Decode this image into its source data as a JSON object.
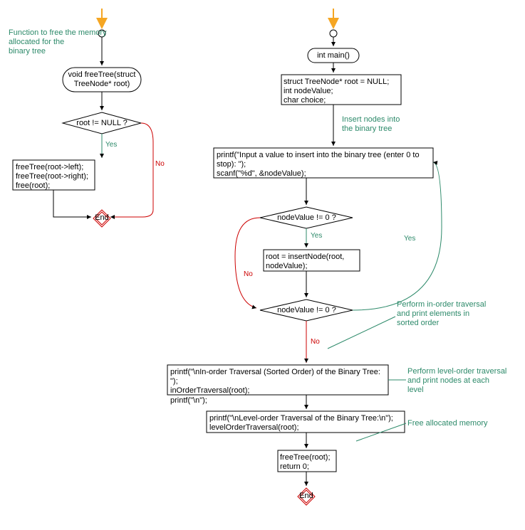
{
  "chart_data": {
    "type": "flowchart",
    "flowcharts": [
      {
        "title_annotation": "Function to free the memory allocated for the binary tree",
        "nodes": [
          {
            "id": "f_start",
            "type": "start",
            "label": ""
          },
          {
            "id": "f_func",
            "type": "terminal",
            "label": "void freeTree(struct TreeNode* root)"
          },
          {
            "id": "f_cond",
            "type": "decision",
            "label": "root != NULL ?"
          },
          {
            "id": "f_body",
            "type": "process",
            "label": "freeTree(root->left);\nfreeTree(root->right);\nfree(root);"
          },
          {
            "id": "f_end",
            "type": "end",
            "label": "End"
          }
        ],
        "edges": [
          {
            "from": "f_start",
            "to": "f_func"
          },
          {
            "from": "f_func",
            "to": "f_cond"
          },
          {
            "from": "f_cond",
            "to": "f_body",
            "label": "Yes"
          },
          {
            "from": "f_cond",
            "to": "f_end",
            "label": "No"
          },
          {
            "from": "f_body",
            "to": "f_end"
          }
        ]
      },
      {
        "nodes": [
          {
            "id": "m_start",
            "type": "start",
            "label": ""
          },
          {
            "id": "m_func",
            "type": "terminal",
            "label": "int main()"
          },
          {
            "id": "m_decl",
            "type": "process",
            "label": "struct TreeNode* root = NULL;\nint nodeValue;\nchar choice;"
          },
          {
            "id": "m_input",
            "type": "process",
            "label": "printf(\"Input a value to insert into the binary tree (enter 0 to stop): \");\nscanf(\"%d\", &nodeValue);"
          },
          {
            "id": "m_cond1",
            "type": "decision",
            "label": "nodeValue != 0 ?"
          },
          {
            "id": "m_insert",
            "type": "process",
            "label": "root = insertNode(root, nodeValue);"
          },
          {
            "id": "m_cond2",
            "type": "decision",
            "label": "nodeValue != 0 ?"
          },
          {
            "id": "m_inorder",
            "type": "process",
            "label": "printf(\"\\nIn-order Traversal (Sorted Order) of the Binary Tree: \");\ninOrderTraversal(root);\nprintf(\"\\n\");"
          },
          {
            "id": "m_level",
            "type": "process",
            "label": "printf(\"\\nLevel-order Traversal of the Binary Tree:\\n\");\nlevelOrderTraversal(root);"
          },
          {
            "id": "m_free",
            "type": "process",
            "label": "freeTree(root);\nreturn 0;"
          },
          {
            "id": "m_end",
            "type": "end",
            "label": "End"
          }
        ],
        "edges": [
          {
            "from": "m_start",
            "to": "m_func"
          },
          {
            "from": "m_func",
            "to": "m_decl"
          },
          {
            "from": "m_decl",
            "to": "m_input",
            "annotation": "Insert nodes into the binary tree"
          },
          {
            "from": "m_input",
            "to": "m_cond1"
          },
          {
            "from": "m_cond1",
            "to": "m_insert",
            "label": "Yes"
          },
          {
            "from": "m_cond1",
            "to": "m_cond2",
            "label": "No"
          },
          {
            "from": "m_insert",
            "to": "m_cond2"
          },
          {
            "from": "m_cond2",
            "to": "m_input",
            "label": "Yes"
          },
          {
            "from": "m_cond2",
            "to": "m_inorder",
            "label": "No",
            "annotation": "Perform in-order traversal and print elements in sorted order"
          },
          {
            "from": "m_inorder",
            "to": "m_level",
            "annotation": "Perform level-order traversal and print nodes at each level"
          },
          {
            "from": "m_level",
            "to": "m_free",
            "annotation": "Free allocated memory"
          },
          {
            "from": "m_free",
            "to": "m_end"
          }
        ]
      }
    ]
  },
  "left": {
    "annotation": "Function to free the memory\nallocated for the\nbinary tree",
    "func": "void freeTree(struct\nTreeNode* root)",
    "cond": "root != NULL ?",
    "body": "freeTree(root->left);\nfreeTree(root->right);\nfree(root);",
    "end": "End"
  },
  "right": {
    "func": "int main()",
    "decl": "struct TreeNode* root = NULL;\nint nodeValue;\nchar choice;",
    "ann_insert": "Insert nodes into\nthe binary tree",
    "input": "printf(\"Input a value to insert into the binary tree (enter 0 to\nstop): \");\nscanf(\"%d\", &nodeValue);",
    "cond1": "nodeValue != 0 ?",
    "insert": "root = insertNode(root,\nnodeValue);",
    "cond2": "nodeValue != 0 ?",
    "ann_inorder": "Perform in-order traversal\nand print elements in\nsorted order",
    "inorder": "printf(\"\\nIn-order Traversal (Sorted Order) of the Binary Tree: \");\ninOrderTraversal(root);\nprintf(\"\\n\");",
    "ann_level": "Perform level-order traversal\nand print nodes at each\nlevel",
    "level": "printf(\"\\nLevel-order Traversal of the Binary Tree:\\n\");\nlevelOrderTraversal(root);",
    "ann_free": "Free allocated memory",
    "free": "freeTree(root);\nreturn 0;",
    "end": "End"
  },
  "labels": {
    "yes": "Yes",
    "no": "No"
  }
}
